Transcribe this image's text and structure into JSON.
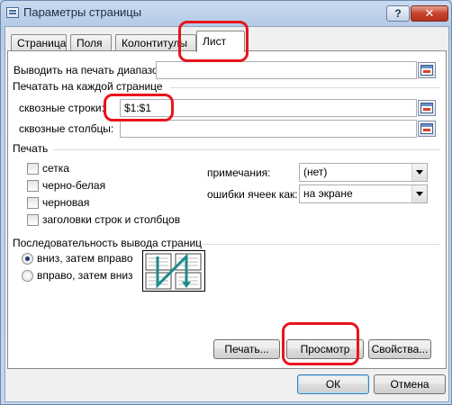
{
  "window": {
    "title": "Параметры страницы",
    "help_label": "?",
    "close_label": "✕"
  },
  "tabs": [
    {
      "label": "Страница",
      "active": false
    },
    {
      "label": "Поля",
      "active": false
    },
    {
      "label": "Колонтитулы",
      "active": false
    },
    {
      "label": "Лист",
      "active": true
    }
  ],
  "print_area": {
    "label": "Выводить на печать диапазон:",
    "value": ""
  },
  "titles_group": {
    "heading": "Печатать на каждой странице",
    "rows_label": "сквозные строки:",
    "rows_value": "$1:$1",
    "cols_label": "сквозные столбцы:",
    "cols_value": ""
  },
  "print_group": {
    "heading": "Печать",
    "checkboxes": [
      {
        "label": "сетка",
        "checked": false
      },
      {
        "label": "черно-белая",
        "checked": false
      },
      {
        "label": "черновая",
        "checked": false
      },
      {
        "label": "заголовки строк и столбцов",
        "checked": false
      }
    ],
    "comments_label": "примечания:",
    "comments_value": "(нет)",
    "errors_label": "ошибки ячеек как:",
    "errors_value": "на экране"
  },
  "order_group": {
    "heading": "Последовательность вывода страниц",
    "options": [
      {
        "label": "вниз, затем вправо",
        "selected": true
      },
      {
        "label": "вправо, затем вниз",
        "selected": false
      }
    ]
  },
  "buttons": {
    "print": "Печать...",
    "preview": "Просмотр",
    "properties": "Свойства...",
    "ok": "ОК",
    "cancel": "Отмена"
  },
  "colors": {
    "highlight": "#e8141b",
    "order_arrow": "#1f8a8a"
  }
}
